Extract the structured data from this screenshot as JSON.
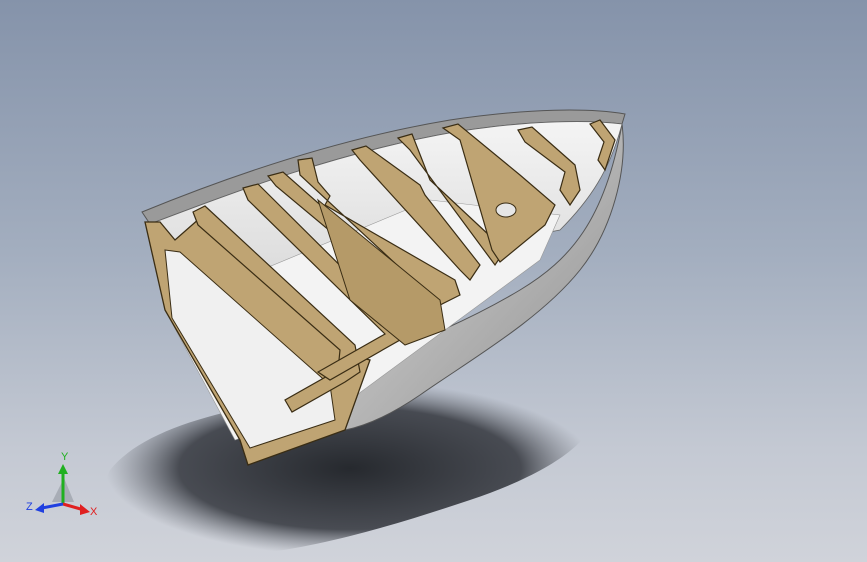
{
  "viewport": {
    "background_top": "#8593aa",
    "background_bottom": "#d0d3da"
  },
  "model": {
    "hull_color": "#c8c8c8",
    "frame_color": "#bfa473",
    "frame_edge_color": "#3a2d14",
    "floor_color": "#f2f2f2",
    "shadow_color": "#2c2f35"
  },
  "triad": {
    "x_label": "X",
    "y_label": "Y",
    "z_label": "Z",
    "x_color": "#e02020",
    "y_color": "#20b020",
    "z_color": "#2040e0"
  }
}
